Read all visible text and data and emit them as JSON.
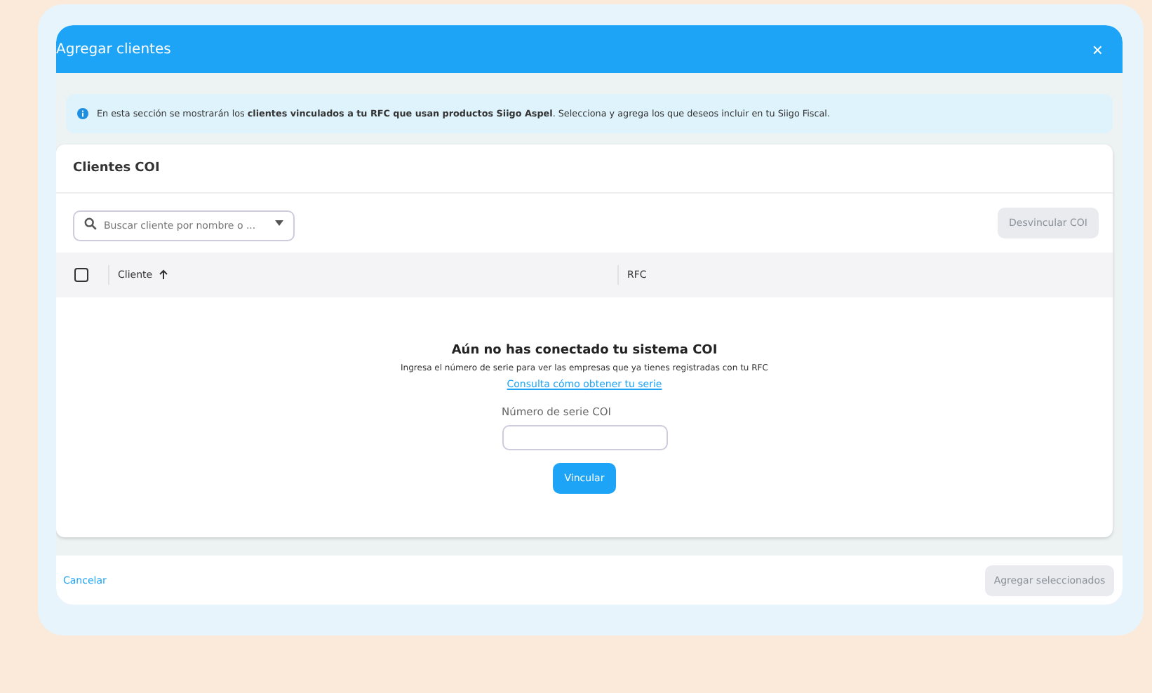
{
  "dialog": {
    "title": "Agregar clientes",
    "close": "×"
  },
  "info": "En esta sección se mostrarán los **clientes vinculados a tu RFC que usan productos Siigo Aspel**. Selecciona y agrega los que deseos incluir en tu Siigo Fiscal.",
  "card": {
    "title": "Clientes COI",
    "search": {
      "placeholder": "Buscar cliente por nombre o ..."
    },
    "unlink_button": {
      "label": "Desvincular COI",
      "disabled": true
    },
    "table": {
      "select_all": {
        "checked": false
      },
      "columns": [
        {
          "label": "Cliente",
          "sorted": true
        },
        {
          "label": "RFC",
          "sorted": false
        }
      ]
    },
    "empty": {
      "title": "Aún no has conectado tu sistema COI",
      "text": "Ingresa el número de serie para ver las empresas que ya tienes registradas con tu RFC",
      "link": "Consulta cómo obtener tu serie",
      "field_label": "Número de serie COI",
      "button": "Vincular"
    }
  },
  "footer": {
    "cancel": "Cancelar",
    "add_button": {
      "label": "Agregar seleccionados",
      "disabled": true
    }
  }
}
